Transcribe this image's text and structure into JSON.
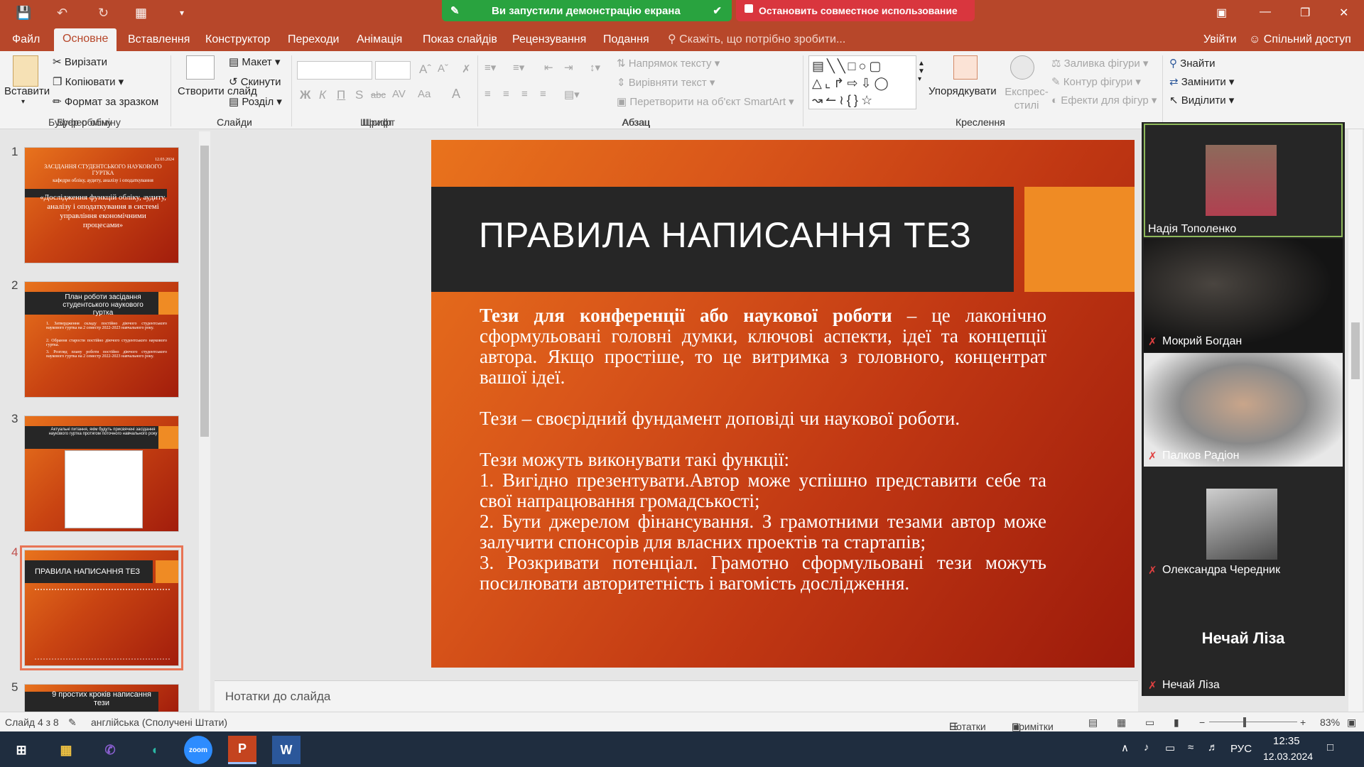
{
  "titlebar": {
    "share_banner": "Ви запустили демонстрацію екрана",
    "stop_banner": "Остановить совместное использование"
  },
  "tabs": [
    "Файл",
    "Основне",
    "Вставлення",
    "Конструктор",
    "Переходи",
    "Анімація",
    "Показ слайдів",
    "Рецензування",
    "Подання"
  ],
  "active_tab": "Основне",
  "tell_me": "Скажіть, що потрібно зробити...",
  "sign_in": "Увійти",
  "share_access": "Спільний доступ",
  "ribbon": {
    "clipboard": {
      "paste": "Вставити",
      "cut": "Вирізати",
      "copy": "Копіювати",
      "format_painter": "Формат за зразком",
      "group": "Буфер обміну"
    },
    "slides": {
      "new_slide": "Створити слайд",
      "layout": "Макет",
      "reset": "Скинути",
      "section": "Розділ",
      "group": "Слайди"
    },
    "font": {
      "bold": "Ж",
      "italic": "К",
      "underline": "П",
      "shadow": "S",
      "strike": "abc",
      "spacing": "AV",
      "case": "Aa",
      "color": "A",
      "group": "Шрифт"
    },
    "paragraph": {
      "text_dir": "Напрямок тексту",
      "align_text": "Вирівняти текст",
      "smartart": "Перетворити на об'єкт SmartArt",
      "group": "Абзац"
    },
    "drawing": {
      "arrange": "Упорядкувати",
      "quick_styles": "Експрес-стилі",
      "fill": "Заливка фігури",
      "outline": "Контур фігури",
      "effects": "Ефекти для фігур",
      "group": "Креслення"
    },
    "editing": {
      "find": "Знайти",
      "replace": "Замінити",
      "select": "Виділити",
      "group": "Редагування"
    }
  },
  "thumbnails": [
    {
      "num": "1",
      "date": "12.03.2024",
      "title": "ЗАСІДАННЯ СТУДЕНТСЬКОГО НАУКОВОГО ГУРТКА",
      "sub": "кафедри обліку, аудиту, аналізу і оподаткування",
      "quote": "«Дослідження функцій обліку, аудиту, аналізу і оподаткування в системі управління економічними процесами»"
    },
    {
      "num": "2",
      "title": "План роботи засідання студентського наукового гуртка",
      "items": [
        "1. Затвердження складу постійно діючого студентського наукового гуртка на 2 семестр 2022-2023 навчального року.",
        "2. Обрання старости постійно діючого студентського наукового гуртка.",
        "3. Розгляд плану роботи постійно діючого студентського наукового гуртка на 2 семестр 2022-2023 навчального року."
      ]
    },
    {
      "num": "3",
      "title": "Актуальні питання, якім будуть присвячені засідання наукового гуртка протягом поточного навчального року"
    },
    {
      "num": "4",
      "title": "ПРАВИЛА НАПИСАННЯ ТЕЗ"
    },
    {
      "num": "5",
      "title": "9 простих кроків написання тези"
    }
  ],
  "slide": {
    "title": "ПРАВИЛА НАПИСАННЯ ТЕЗ",
    "p1_bold": "Тези для конференції або наукової роботи",
    "p1_rest": " – це лаконічно сформульовані головні думки, ключові аспекти, ідеї та концепції автора.   Якщо простіше, то це витримка з головного, концентрат вашої ідеї.",
    "p2": "Тези – своєрідний фундамент доповіді чи наукової роботи.",
    "p3_head": "Тези можуть виконувати такі функції:",
    "p3_items": [
      "1. Вигідно презентувати.Автор може успішно представити себе та свої  напрацювання громадськості;",
      "2. Бути джерелом фінансування. З грамотними тезами автор може залучити спонсорів для власних проектів та стартапів;",
      "3. Розкривати потенціал. Грамотно сформульовані тези можуть посилювати авторитетність і вагомість дослідження."
    ]
  },
  "notes_placeholder": "Нотатки до слайда",
  "participants": [
    {
      "name": "Надія Тополенко",
      "muted": false,
      "video": "photo"
    },
    {
      "name": "Мокрий Богдан",
      "muted": true,
      "video": "dark"
    },
    {
      "name": "Палков Радіон",
      "muted": true,
      "video": "light"
    },
    {
      "name": "Олександра Чередник",
      "muted": true,
      "video": "photo"
    },
    {
      "name": "Нечай Ліза",
      "muted": true,
      "video": "none",
      "big_name": "Нечай Ліза"
    }
  ],
  "status": {
    "slide_of": "Слайд 4 з 8",
    "language": "англійська (Сполучені Штати)",
    "notes": "Нотатки",
    "comments": "Примітки",
    "zoom": "83%"
  },
  "taskbar": {
    "zoom_label": "zoom",
    "lang": "РУС",
    "time": "12:35",
    "date": "12.03.2024"
  },
  "colors": {
    "accent": "#b7472a",
    "share_green": "#29a33f",
    "stop_red": "#d9363e"
  }
}
